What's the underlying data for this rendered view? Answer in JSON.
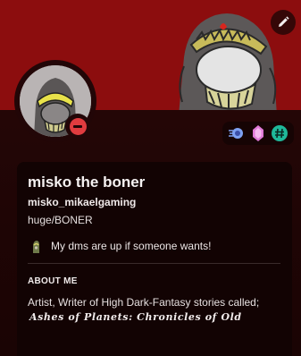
{
  "profile": {
    "display_name": "misko the boner",
    "username": "misko_mikaelgaming",
    "pronouns": "huge/BONER",
    "custom_status": "My dms are up if someone wants!",
    "status": "do-not-disturb"
  },
  "about": {
    "title": "ABOUT ME",
    "text": "Artist, Writer of High Dark-Fantasy stories called;",
    "fancy": "Ashes of Planets: Chronicles of Old"
  },
  "badges": [
    "hypesquad-balance-icon",
    "nitro-boost-gem-icon",
    "originally-known-as-hashtag-icon"
  ],
  "colors": {
    "banner": "#8c0d0e",
    "card_background": "#2a0708",
    "info_panel": "#120303",
    "dnd_status": "#e03c3f",
    "gem": "#e07ad8",
    "hashtag_badge": "#1fb89a"
  }
}
